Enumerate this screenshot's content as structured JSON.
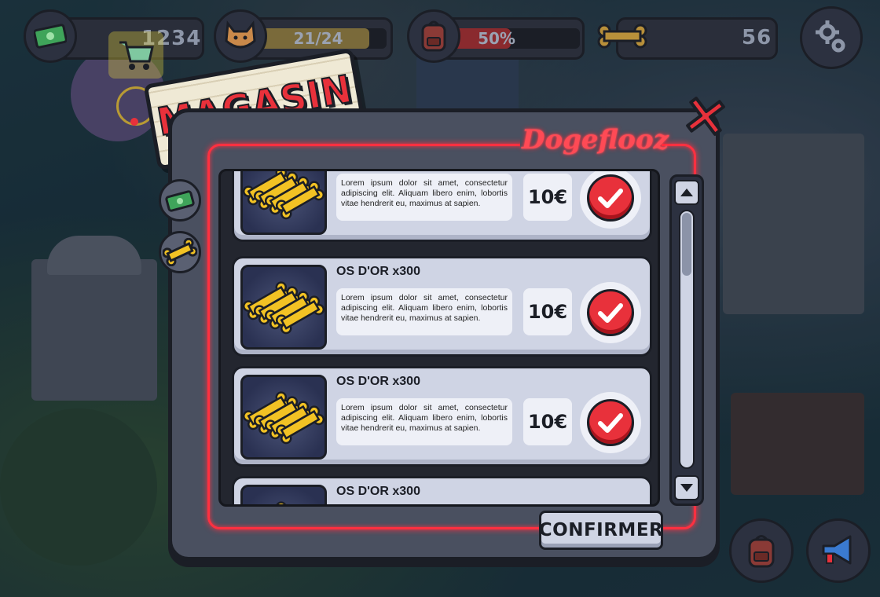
{
  "hud": {
    "cash": {
      "value": "1234",
      "icon": "cash-icon"
    },
    "dogs": {
      "value": "21/24",
      "progress": 0.875,
      "icon": "dog-face-icon",
      "bar_color": "#7a6a3a"
    },
    "backpack": {
      "value": "50%",
      "progress": 0.5,
      "icon": "backpack-icon",
      "bar_color": "#8a2a2e"
    },
    "bones": {
      "value": "56",
      "icon": "bone-icon"
    },
    "settings_icon": "gear-icon"
  },
  "shop": {
    "title": "MAGASIN",
    "brand": "Dogeflooz",
    "close_icon": "close-x-icon",
    "side_tabs": [
      {
        "icon": "cash-stack-icon"
      },
      {
        "icon": "bone-icon"
      }
    ],
    "items": [
      {
        "name": "",
        "description": "Lorem ipsum dolor sit amet, consectetur adipiscing elit. Aliquam libero enim, lobortis vitae hendrerit eu, maximus at sapien.",
        "price": "10€"
      },
      {
        "name": "OS D'OR x300",
        "description": "Lorem ipsum dolor sit amet, consectetur adipiscing elit. Aliquam libero enim, lobortis vitae hendrerit eu, maximus at sapien.",
        "price": "10€"
      },
      {
        "name": "OS D'OR x300",
        "description": "Lorem ipsum dolor sit amet, consectetur adipiscing elit. Aliquam libero enim, lobortis vitae hendrerit eu, maximus at sapien.",
        "price": "10€"
      },
      {
        "name": "OS D'OR x300",
        "description": "",
        "price": ""
      }
    ],
    "confirm_label": "CONFIRMER"
  },
  "bottom_bar": [
    {
      "icon": "backpack-icon"
    },
    {
      "icon": "megaphone-icon"
    }
  ],
  "colors": {
    "accent_red": "#e8313b",
    "neon": "#ff3040",
    "gold": "#f2c224"
  }
}
